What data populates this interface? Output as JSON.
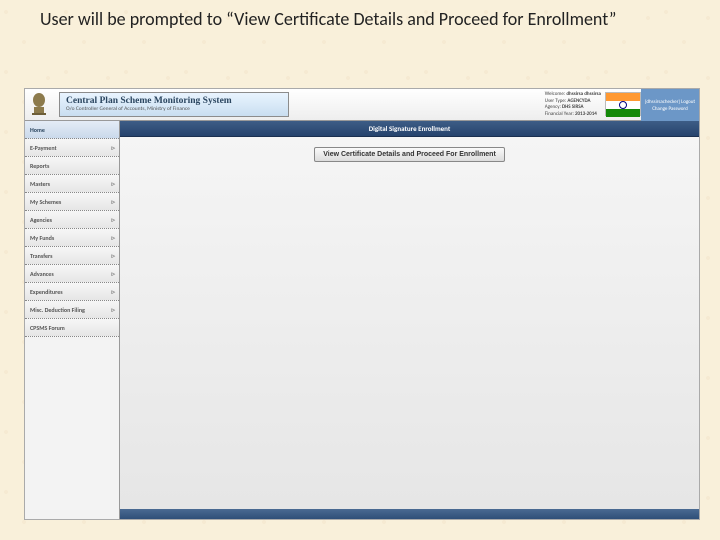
{
  "instruction": "User will be prompted to “View Certificate Details and Proceed for Enrollment”",
  "header": {
    "title_line1": "Central Plan Scheme Monitoring System",
    "title_line2": "O/o Controller General of Accounts, Ministry of Finance",
    "welcome_label": "Welcome:",
    "welcome_value": "dhssirsa dhssirsa",
    "usertype_label": "User Type:",
    "usertype_value": "AGENCYDA",
    "agency_label": "Agency:",
    "agency_value": "DHS SIRSA",
    "fy_label": "Financial Year:",
    "fy_value": "2013-2014",
    "corner_user": "[dhssirsachecker]",
    "corner_logout": "Logout",
    "corner_changepw": "Change Password"
  },
  "sidebar": {
    "items": [
      {
        "label": "Home",
        "expandable": false
      },
      {
        "label": "E-Payment",
        "expandable": true
      },
      {
        "label": "Reports",
        "expandable": false
      },
      {
        "label": "Masters",
        "expandable": true
      },
      {
        "label": "My Schemes",
        "expandable": true
      },
      {
        "label": "Agencies",
        "expandable": true
      },
      {
        "label": "My Funds",
        "expandable": true
      },
      {
        "label": "Transfers",
        "expandable": true
      },
      {
        "label": "Advances",
        "expandable": true
      },
      {
        "label": "Expenditures",
        "expandable": true
      },
      {
        "label": "Misc. Deduction Filing",
        "expandable": true
      },
      {
        "label": "CPSMS Forum",
        "expandable": false
      }
    ]
  },
  "page": {
    "heading": "Digital Signature Enrollment",
    "button_label": "View Certificate Details and Proceed For Enrollment"
  }
}
